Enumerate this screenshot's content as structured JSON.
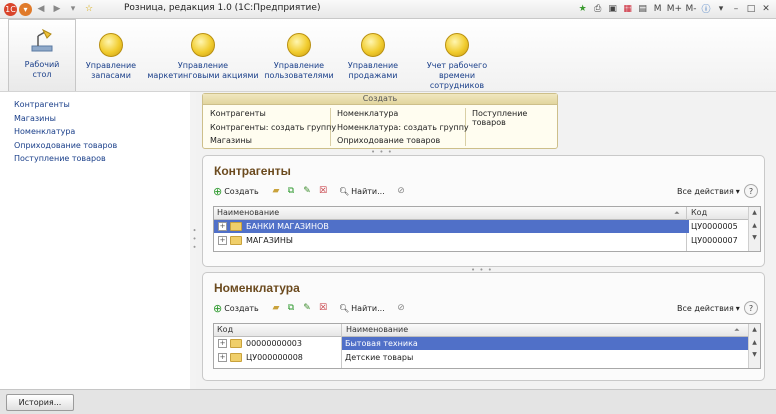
{
  "window": {
    "title": "Розница, редакция 1.0  (1С:Предприятие)",
    "right_controls": [
      "M",
      "M+",
      "M-"
    ]
  },
  "sections": [
    {
      "label": "Рабочий стол",
      "line1": "Рабочий",
      "line2": "стол",
      "active": true
    },
    {
      "label": "Управление запасами",
      "line1": "Управление",
      "line2": "запасами"
    },
    {
      "label": "Управление маркетинговыми акциями",
      "line1": "Управление",
      "line2": "маркетинговыми акциями"
    },
    {
      "label": "Управление пользователями",
      "line1": "Управление",
      "line2": "пользователями"
    },
    {
      "label": "Управление продажами",
      "line1": "Управление",
      "line2": "продажами"
    },
    {
      "label": "Учет рабочего времени сотрудников",
      "line1": "Учет рабочего",
      "line2": "времени сотрудников"
    }
  ],
  "sidebar": {
    "items": [
      "Контрагенты",
      "Магазины",
      "Номенклатура",
      "Оприходование товаров",
      "Поступление товаров"
    ]
  },
  "create_panel": {
    "header": "Создать",
    "col1": [
      "Контрагенты",
      "Контрагенты: создать группу",
      "Магазины"
    ],
    "col2": [
      "Номенклатура",
      "Номенклатура: создать группу",
      "Оприходование товаров"
    ],
    "col3": [
      "Поступление товаров"
    ]
  },
  "kontragenty": {
    "title": "Контрагенты",
    "create_label": "Создать",
    "find_label": "Найти...",
    "all_actions_label": "Все действия",
    "columns": [
      "Наименование",
      "Код"
    ],
    "rows": [
      {
        "name": "БАНКИ МАГАЗИНОВ",
        "code": "ЦУ0000005",
        "selected": true
      },
      {
        "name": "МАГАЗИНЫ",
        "code": "ЦУ0000007",
        "selected": false
      }
    ]
  },
  "nomenklatura": {
    "title": "Номенклатура",
    "create_label": "Создать",
    "find_label": "Найти...",
    "all_actions_label": "Все действия",
    "columns": [
      "Код",
      "Наименование"
    ],
    "rows": [
      {
        "code": "00000000003",
        "name": "Бытовая техника",
        "selected": true
      },
      {
        "code": "ЦУ000000008",
        "name": "Детские товары",
        "selected": false
      }
    ]
  },
  "status_bar": {
    "history_label": "История..."
  },
  "colors": {
    "selection": "#5070c8",
    "section_title": "#6b4a1e",
    "link": "#1a3f8a"
  }
}
